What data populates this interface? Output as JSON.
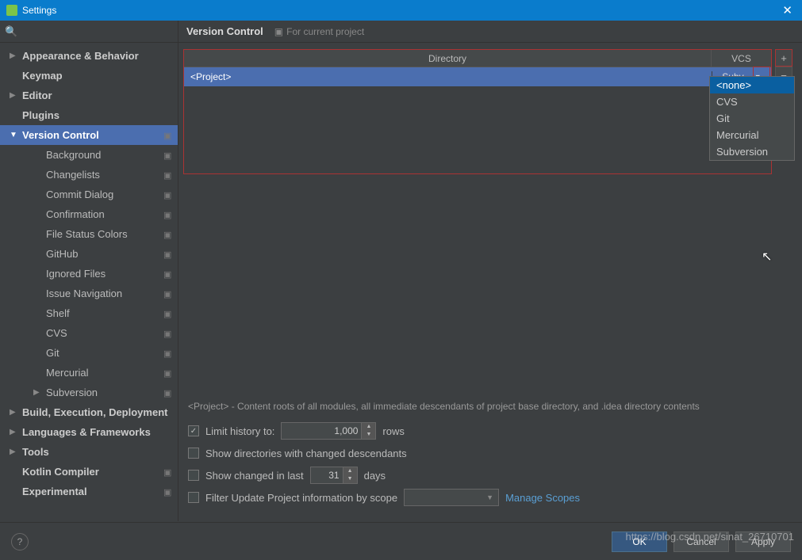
{
  "window": {
    "title": "Settings"
  },
  "search": {
    "placeholder": ""
  },
  "sidebar": {
    "items": [
      {
        "label": "Appearance & Behavior",
        "bold": true,
        "depth": 0,
        "arrow": "▶",
        "badge": false
      },
      {
        "label": "Keymap",
        "bold": true,
        "depth": 0,
        "arrow": "",
        "badge": false
      },
      {
        "label": "Editor",
        "bold": true,
        "depth": 0,
        "arrow": "▶",
        "badge": false
      },
      {
        "label": "Plugins",
        "bold": true,
        "depth": 0,
        "arrow": "",
        "badge": false
      },
      {
        "label": "Version Control",
        "bold": true,
        "depth": 0,
        "arrow": "▼",
        "badge": true,
        "selected": true
      },
      {
        "label": "Background",
        "depth": 2,
        "arrow": "",
        "badge": true
      },
      {
        "label": "Changelists",
        "depth": 2,
        "arrow": "",
        "badge": true
      },
      {
        "label": "Commit Dialog",
        "depth": 2,
        "arrow": "",
        "badge": true
      },
      {
        "label": "Confirmation",
        "depth": 2,
        "arrow": "",
        "badge": true
      },
      {
        "label": "File Status Colors",
        "depth": 2,
        "arrow": "",
        "badge": true
      },
      {
        "label": "GitHub",
        "depth": 2,
        "arrow": "",
        "badge": true
      },
      {
        "label": "Ignored Files",
        "depth": 2,
        "arrow": "",
        "badge": true
      },
      {
        "label": "Issue Navigation",
        "depth": 2,
        "arrow": "",
        "badge": true
      },
      {
        "label": "Shelf",
        "depth": 2,
        "arrow": "",
        "badge": true
      },
      {
        "label": "CVS",
        "depth": 2,
        "arrow": "",
        "badge": true
      },
      {
        "label": "Git",
        "depth": 2,
        "arrow": "",
        "badge": true
      },
      {
        "label": "Mercurial",
        "depth": 2,
        "arrow": "",
        "badge": true
      },
      {
        "label": "Subversion",
        "depth": 2,
        "arrow": "▶",
        "badge": true
      },
      {
        "label": "Build, Execution, Deployment",
        "bold": true,
        "depth": 0,
        "arrow": "▶",
        "badge": false
      },
      {
        "label": "Languages & Frameworks",
        "bold": true,
        "depth": 0,
        "arrow": "▶",
        "badge": false
      },
      {
        "label": "Tools",
        "bold": true,
        "depth": 0,
        "arrow": "▶",
        "badge": false
      },
      {
        "label": "Kotlin Compiler",
        "bold": true,
        "depth": 0,
        "arrow": "",
        "badge": true
      },
      {
        "label": "Experimental",
        "bold": true,
        "depth": 0,
        "arrow": "",
        "badge": true
      }
    ]
  },
  "content": {
    "title": "Version Control",
    "subtitle": "For current project",
    "table": {
      "headers": {
        "dir": "Directory",
        "vcs": "VCS"
      },
      "row": {
        "dir": "<Project>",
        "vcs": "Subv..."
      }
    },
    "actions": {
      "add": "+",
      "remove": "−"
    },
    "vcs_options": [
      "<none>",
      "CVS",
      "Git",
      "Mercurial",
      "Subversion"
    ],
    "description": "<Project> - Content roots of all modules, all immediate descendants of project base directory, and .idea directory contents",
    "options": {
      "limit_history_label": "Limit history to:",
      "limit_history_value": "1,000",
      "limit_history_unit": "rows",
      "show_dirs_label": "Show directories with changed descendants",
      "show_changed_label_pre": "Show changed in last",
      "show_changed_value": "31",
      "show_changed_unit": "days",
      "filter_label": "Filter Update Project information by scope",
      "manage_scopes": "Manage Scopes"
    }
  },
  "footer": {
    "help": "?",
    "ok": "OK",
    "cancel": "Cancel",
    "apply": "Apply"
  },
  "watermark": "https://blog.csdn.net/sinat_26710701"
}
